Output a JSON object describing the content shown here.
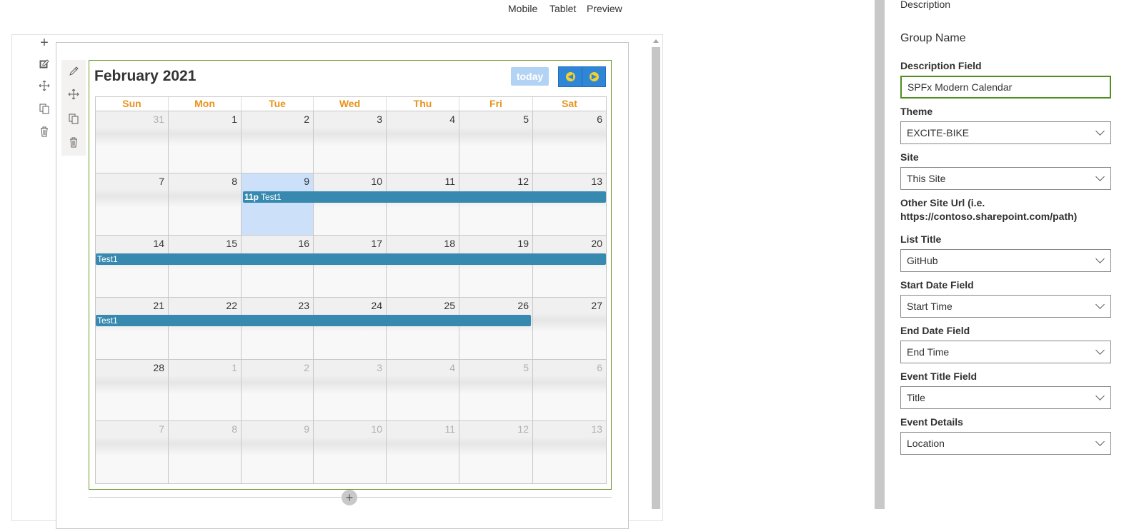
{
  "top_bar": {
    "mobile": "Mobile",
    "tablet": "Tablet",
    "preview": "Preview"
  },
  "calendar": {
    "title": "February 2021",
    "today_label": "today",
    "day_headers": [
      "Sun",
      "Mon",
      "Tue",
      "Wed",
      "Thu",
      "Fri",
      "Sat"
    ],
    "weeks": [
      [
        "31",
        "1",
        "2",
        "3",
        "4",
        "5",
        "6"
      ],
      [
        "7",
        "8",
        "9",
        "10",
        "11",
        "12",
        "13"
      ],
      [
        "14",
        "15",
        "16",
        "17",
        "18",
        "19",
        "20"
      ],
      [
        "21",
        "22",
        "23",
        "24",
        "25",
        "26",
        "27"
      ],
      [
        "28",
        "1",
        "2",
        "3",
        "4",
        "5",
        "6"
      ],
      [
        "7",
        "8",
        "9",
        "10",
        "11",
        "12",
        "13"
      ]
    ],
    "events": {
      "week2": {
        "time": "11p",
        "title": "Test1"
      },
      "week3": {
        "title": "Test1"
      },
      "week4": {
        "title": "Test1"
      }
    },
    "colors": {
      "header_text": "#e8931c",
      "event": "#3789b0",
      "today_cell": "#cce0fa",
      "nav_button": "#2f86d6"
    }
  },
  "property_pane": {
    "top_label": "Description",
    "group_name": "Group Name",
    "description_field": {
      "label": "Description Field",
      "value": "SPFx Modern Calendar"
    },
    "theme": {
      "label": "Theme",
      "value": "EXCITE-BIKE"
    },
    "site": {
      "label": "Site",
      "value": "This Site"
    },
    "other_site_url": {
      "label_line1": "Other Site Url (i.e.",
      "label_line2": "https://contoso.sharepoint.com/path)"
    },
    "list_title": {
      "label": "List Title",
      "value": "GitHub"
    },
    "start_date_field": {
      "label": "Start Date Field",
      "value": "Start Time"
    },
    "end_date_field": {
      "label": "End Date Field",
      "value": "End Time"
    },
    "event_title_field": {
      "label": "Event Title Field",
      "value": "Title"
    },
    "event_details": {
      "label": "Event Details",
      "value": "Location"
    }
  }
}
